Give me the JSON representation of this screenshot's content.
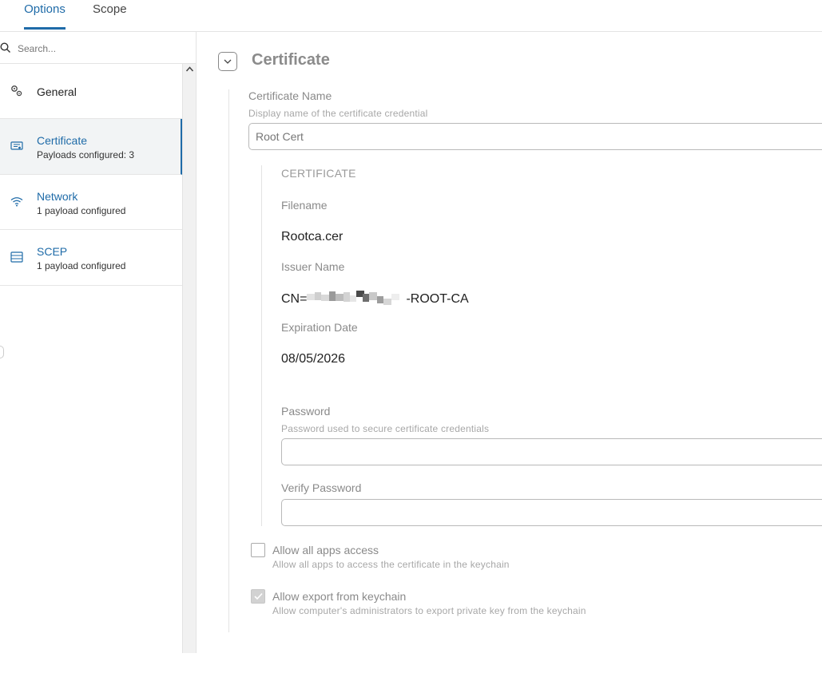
{
  "tabs": [
    {
      "label": "Options",
      "active": true
    },
    {
      "label": "Scope",
      "active": false
    }
  ],
  "search": {
    "placeholder": "Search..."
  },
  "sidebar": {
    "items": [
      {
        "title": "General",
        "subtitle": "",
        "icon": "gears-icon"
      },
      {
        "title": "Certificate",
        "subtitle": "Payloads configured: 3",
        "icon": "certificate-icon",
        "selected": true
      },
      {
        "title": "Network",
        "subtitle": "1 payload configured",
        "icon": "wifi-icon"
      },
      {
        "title": "SCEP",
        "subtitle": "1 payload configured",
        "icon": "list-icon"
      }
    ]
  },
  "main": {
    "section_title": "Certificate",
    "certificate_name": {
      "label": "Certificate Name",
      "hint": "Display name of the certificate credential",
      "value": "Root Cert"
    },
    "certificate": {
      "heading": "CERTIFICATE",
      "filename_label": "Filename",
      "filename_value": "Rootca.cer",
      "issuer_label": "Issuer Name",
      "issuer_prefix": "CN=",
      "issuer_suffix": "-ROOT-CA",
      "expiration_label": "Expiration Date",
      "expiration_value": "08/05/2026",
      "password_label": "Password",
      "password_hint": "Password used to secure certificate credentials",
      "password_value": "",
      "verify_label": "Verify Password",
      "verify_value": ""
    },
    "allow_all_apps": {
      "label": "Allow all apps access",
      "hint": "Allow all apps to access the certificate in the keychain",
      "checked": false
    },
    "allow_export": {
      "label": "Allow export from keychain",
      "hint": "Allow computer's administrators to export private key from the keychain",
      "checked": true
    }
  },
  "colors": {
    "accent": "#1f6ba8",
    "muted_text": "#8a8a8a"
  }
}
